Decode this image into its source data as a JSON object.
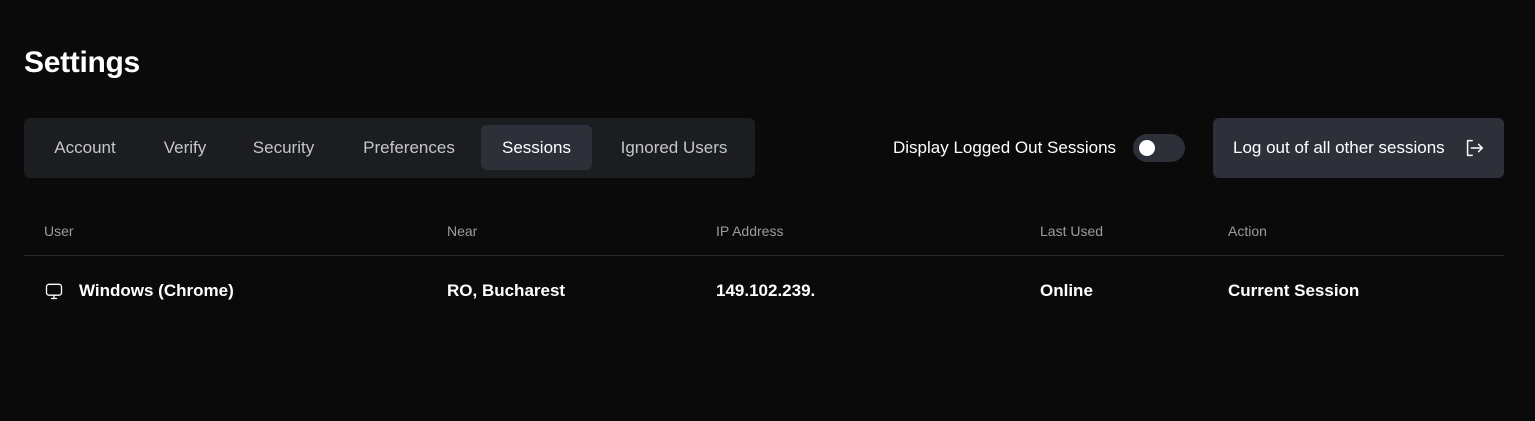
{
  "page": {
    "title": "Settings"
  },
  "tabs": [
    {
      "label": "Account",
      "active": false
    },
    {
      "label": "Verify",
      "active": false
    },
    {
      "label": "Security",
      "active": false
    },
    {
      "label": "Preferences",
      "active": false
    },
    {
      "label": "Sessions",
      "active": true
    },
    {
      "label": "Ignored Users",
      "active": false
    }
  ],
  "controls": {
    "toggle_label": "Display Logged Out Sessions",
    "toggle_on": false,
    "logout_label": "Log out of all other sessions",
    "logout_icon": "logout-icon"
  },
  "table": {
    "headers": {
      "user": "User",
      "near": "Near",
      "ip": "IP Address",
      "last_used": "Last Used",
      "action": "Action"
    },
    "rows": [
      {
        "icon": "monitor-icon",
        "user": "Windows (Chrome)",
        "near": "RO, Bucharest",
        "ip": "149.102.239.",
        "last_used": "Online",
        "action": "Current Session"
      }
    ]
  },
  "colors": {
    "background": "#0a0a0a",
    "panel": "#1c1d21",
    "active": "#2d3039",
    "muted_text": "#9a9ca3"
  }
}
